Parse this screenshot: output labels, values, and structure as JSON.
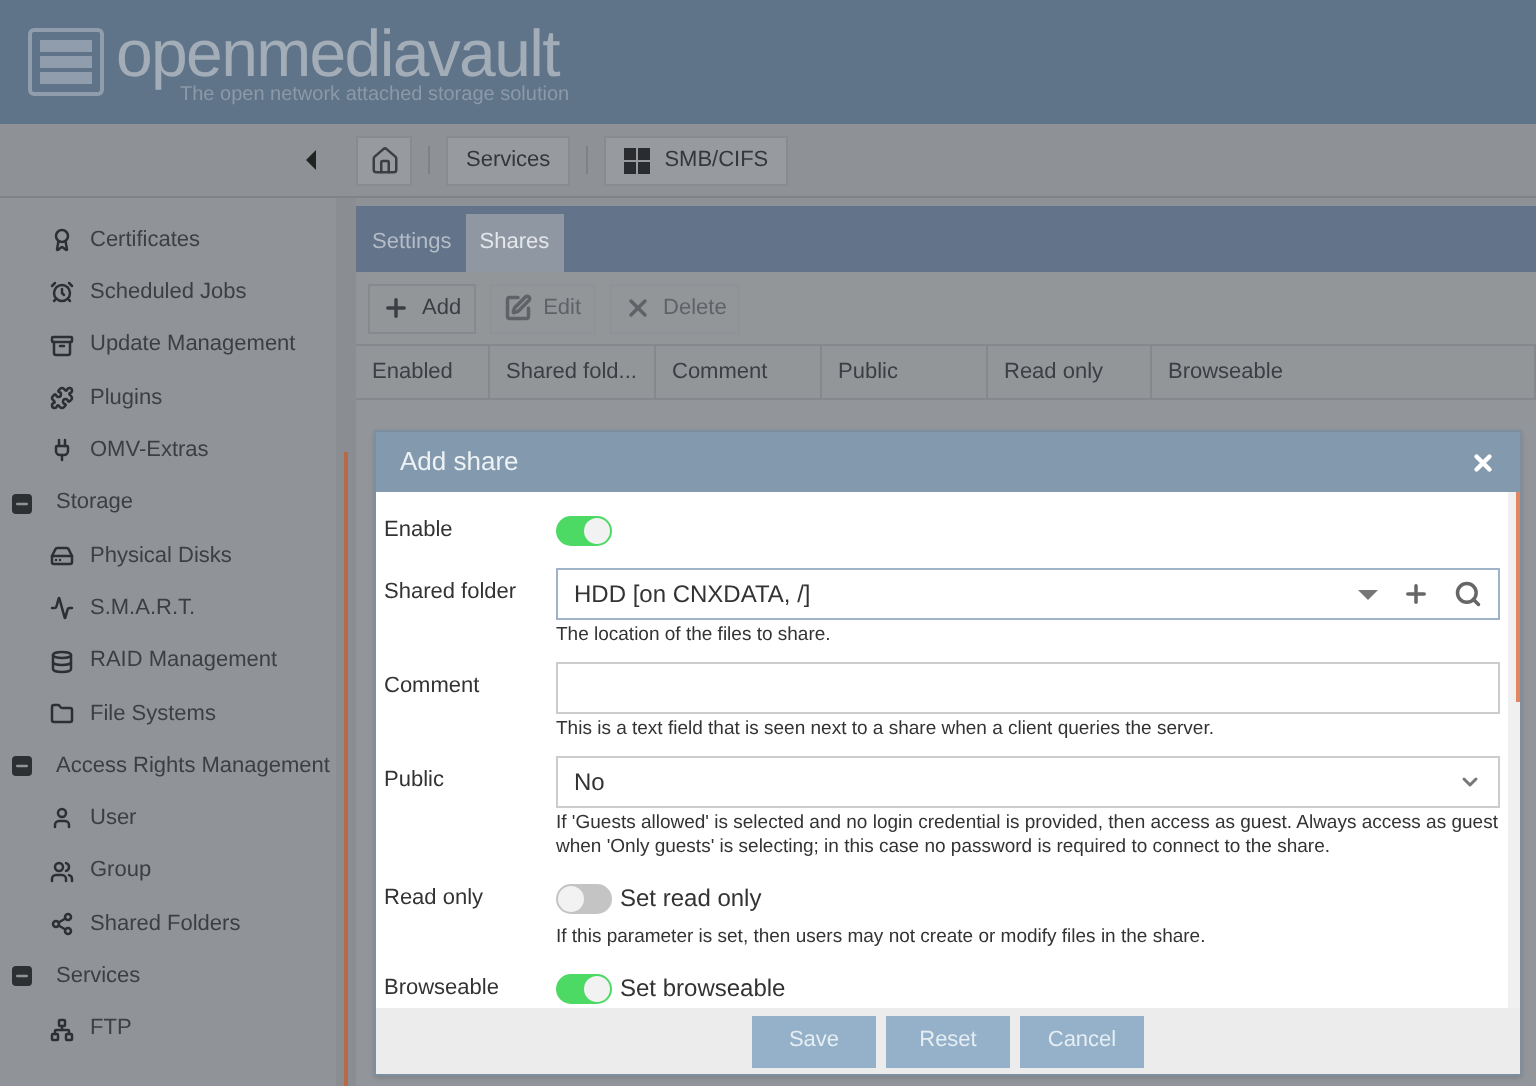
{
  "header": {
    "logo": "openmediavault",
    "tagline": "The open network attached storage solution"
  },
  "breadcrumb": {
    "items": [
      "Services",
      "SMB/CIFS"
    ]
  },
  "sidebar": {
    "sections": [
      {
        "items": [
          "Certificates",
          "Scheduled Jobs",
          "Update Management",
          "Plugins",
          "OMV-Extras"
        ]
      },
      {
        "title": "Storage",
        "expanded": true,
        "items": [
          "Physical Disks",
          "S.M.A.R.T.",
          "RAID Management",
          "File Systems"
        ]
      },
      {
        "title": "Access Rights Management",
        "expanded": true,
        "items": [
          "User",
          "Group",
          "Shared Folders"
        ]
      },
      {
        "title": "Services",
        "expanded": true,
        "items": [
          "FTP"
        ]
      }
    ]
  },
  "tabs": [
    {
      "label": "Settings",
      "selected": false
    },
    {
      "label": "Shares",
      "selected": true
    }
  ],
  "toolbar": [
    {
      "label": "Add",
      "disabled": false
    },
    {
      "label": "Edit",
      "disabled": true
    },
    {
      "label": "Delete",
      "disabled": true
    }
  ],
  "table": {
    "columns": [
      "Enabled",
      "Shared fold...",
      "Comment",
      "Public",
      "Read only",
      "Browseable"
    ]
  },
  "dialog": {
    "title": "Add share",
    "fields": [
      {
        "kind": "switch",
        "label": "Enable",
        "on": true
      },
      {
        "kind": "combo",
        "label": "Shared folder",
        "value": "HDD [on CNXDATA, /]",
        "hint": "The location of the files to share."
      },
      {
        "kind": "text",
        "label": "Comment",
        "hint": "This is a text field that is seen next to a share when a client queries the server."
      },
      {
        "kind": "select",
        "label": "Public",
        "value": "No",
        "hint": "If 'Guests allowed' is selected and no login credential is provided, then access as guest. Always access as guest when 'Only guests' is selecting; in this case no password is required to connect to the share."
      },
      {
        "kind": "switch",
        "label": "Read only",
        "on": false,
        "text": "Set read only",
        "hint": "If this parameter is set, then users may not create or modify files in the share."
      },
      {
        "kind": "switch",
        "label": "Browseable",
        "on": true,
        "text": "Set browseable"
      }
    ],
    "buttons": [
      "Save",
      "Reset",
      "Cancel"
    ]
  }
}
